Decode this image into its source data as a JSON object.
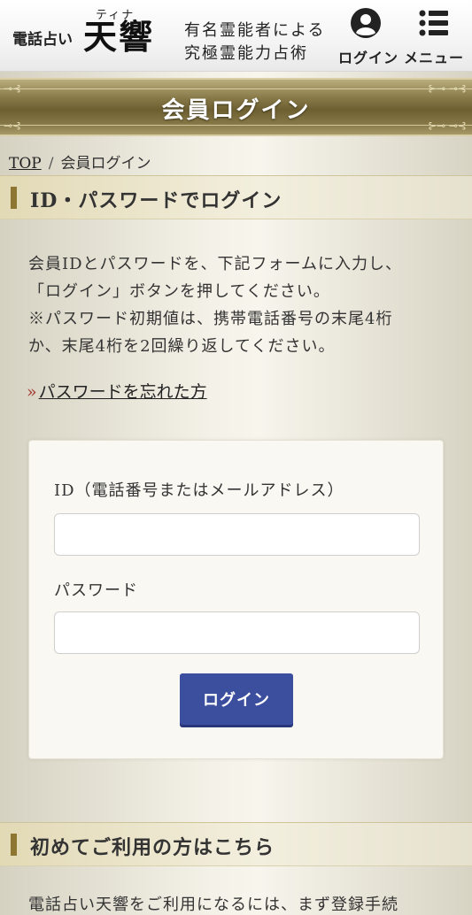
{
  "header": {
    "brand_sub": "電話占い",
    "brand_ruby": "ティナ",
    "brand_main": "天響",
    "tagline_line1": "有名霊能者による",
    "tagline_line2": "究極霊能力占術",
    "login_label": "ログイン",
    "menu_label": "メニュー",
    "login_icon": "user-circle-icon",
    "menu_icon": "hamburger-list-icon"
  },
  "page_title": "会員ログイン",
  "breadcrumb": {
    "home": "TOP",
    "separator": "/",
    "current": "会員ログイン"
  },
  "login_section": {
    "heading": "ID・パスワードでログイン",
    "desc_lines": [
      "会員IDとパスワードを、下記フォームに入力し、",
      "「ログイン」ボタンを押してください。",
      "※パスワード初期値は、携帯電話番号の末尾4桁",
      "か、末尾4桁を2回繰り返してください。"
    ],
    "forgot_arrow": "»",
    "forgot_link": "パスワードを忘れた方"
  },
  "form": {
    "id_label": "ID（電話番号またはメールアドレス）",
    "id_value": "",
    "password_label": "パスワード",
    "password_value": "",
    "submit_label": "ログイン"
  },
  "first_time_section": {
    "heading": "初めてご利用の方はこちら",
    "text_partial": "電話占い天響をご利用になるには、まず登録手続"
  },
  "colors": {
    "band_gold": "#857746",
    "accent_bar": "#8c7632",
    "button_blue": "#3c4f9e",
    "arrow_red": "#a3362c"
  }
}
